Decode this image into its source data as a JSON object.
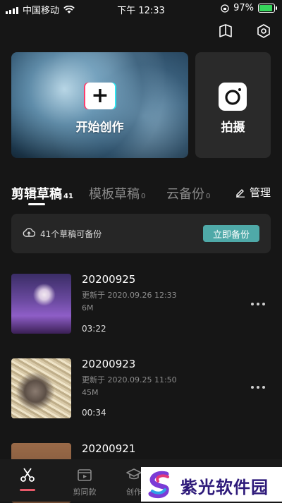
{
  "status_bar": {
    "carrier": "中国移动",
    "time": "下午 12:33",
    "battery": "97%",
    "battery_level": 0.97
  },
  "header": {
    "icons": [
      "book-icon",
      "settings-hex-icon"
    ]
  },
  "hero": {
    "create_label": "开始创作",
    "shoot_label": "拍摄"
  },
  "tabs": [
    {
      "label": "剪辑草稿",
      "count": "41",
      "active": true
    },
    {
      "label": "模板草稿",
      "count": "0",
      "active": false
    },
    {
      "label": "云备份",
      "count": "0",
      "active": false
    }
  ],
  "manage_label": "管理",
  "backup_banner": {
    "text": "41个草稿可备份",
    "button": "立即备份"
  },
  "drafts": [
    {
      "title": "20200925",
      "updated": "更新于 2020.09.26 12:33",
      "size": "6M",
      "duration": "03:22"
    },
    {
      "title": "20200923",
      "updated": "更新于 2020.09.25 11:50",
      "size": "45M",
      "duration": "00:34"
    },
    {
      "title": "20200921"
    }
  ],
  "bottom_nav": [
    {
      "label": "",
      "icon": "scissors-icon",
      "active": true
    },
    {
      "label": "剪同款",
      "icon": "clapper-icon",
      "active": false
    },
    {
      "label": "创作",
      "icon": "graduation-cap-icon",
      "active": false
    }
  ],
  "watermark": {
    "text": "紫光软件园"
  },
  "colors": {
    "background": "#161616",
    "accent_teal": "#4fa9a8",
    "active_nav": "#e85a6a",
    "battery_green": "#36d65b"
  }
}
